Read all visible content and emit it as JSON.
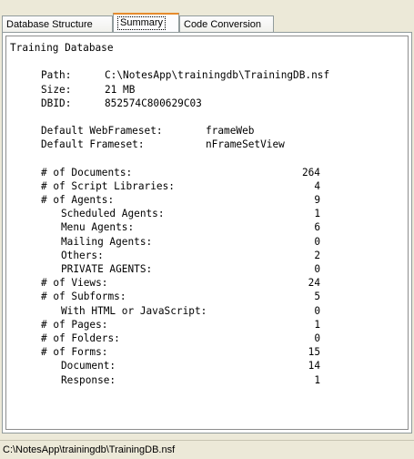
{
  "tabs": [
    {
      "label": "Database Structure"
    },
    {
      "label": "Summary"
    },
    {
      "label": "Code Conversion"
    }
  ],
  "summary": {
    "title": "Training Database",
    "path_label": "Path:",
    "path_value": "C:\\NotesApp\\trainingdb\\TrainingDB.nsf",
    "size_label": "Size:",
    "size_value": "21 MB",
    "dbid_label": "DBID:",
    "dbid_value": "852574C800629C03",
    "webframeset_label": "Default WebFrameset:",
    "webframeset_value": "frameWeb",
    "frameset_label": "Default Frameset:",
    "frameset_value": "nFrameSetView",
    "stats": [
      {
        "label": "# of Documents:",
        "value": "264",
        "indent": 0
      },
      {
        "label": "# of Script Libraries:",
        "value": "4",
        "indent": 0
      },
      {
        "label": "# of Agents:",
        "value": "9",
        "indent": 0
      },
      {
        "label": "Scheduled Agents:",
        "value": "1",
        "indent": 1
      },
      {
        "label": "Menu Agents:",
        "value": "6",
        "indent": 1
      },
      {
        "label": "Mailing Agents:",
        "value": "0",
        "indent": 1
      },
      {
        "label": "Others:",
        "value": "2",
        "indent": 1
      },
      {
        "label": "PRIVATE AGENTS:",
        "value": "0",
        "indent": 1
      },
      {
        "label": "# of Views:",
        "value": "24",
        "indent": 0
      },
      {
        "label": "# of Subforms:",
        "value": "5",
        "indent": 0
      },
      {
        "label": "With HTML or JavaScript:",
        "value": "0",
        "indent": 1
      },
      {
        "label": "# of Pages:",
        "value": "1",
        "indent": 0
      },
      {
        "label": "# of Folders:",
        "value": "0",
        "indent": 0
      },
      {
        "label": "# of Forms:",
        "value": "15",
        "indent": 0
      },
      {
        "label": "Document:",
        "value": "14",
        "indent": 1
      },
      {
        "label": "Response:",
        "value": "1",
        "indent": 1
      }
    ]
  },
  "status_bar": {
    "text": "C:\\NotesApp\\trainingdb\\TrainingDB.nsf"
  }
}
